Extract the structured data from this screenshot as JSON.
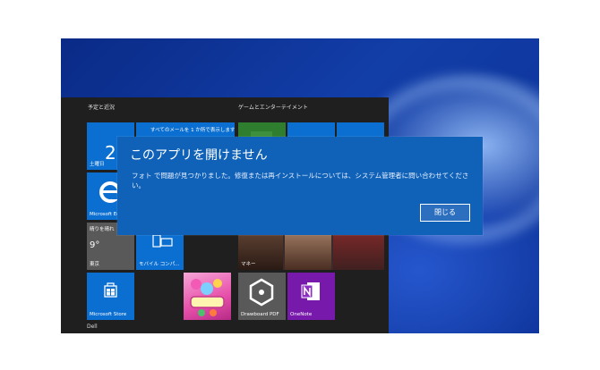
{
  "start_menu": {
    "group_schedule": "予定と近況",
    "group_games": "ゲームとエンターテイメント",
    "footer_user": "Dell",
    "tiles": {
      "calendar_day": "2",
      "mail_label": "すべてのメールを 1 か所で表示します",
      "calendar_label": "土曜日",
      "edge_label": "Microsoft Edge",
      "weather_label": "晴りを晴れ",
      "weather_temp": "9°",
      "weather_city": "東京",
      "mobile_label": "モバイル コンパ...",
      "news_label": "マネー",
      "store_label": "Microsoft Store",
      "drawboard_label": "Drawboard PDF",
      "onenote_label": "OneNote"
    }
  },
  "dialog": {
    "title": "このアプリを開けません",
    "message": "フォト で問題が見つかりました。修復または再インストールについては、システム管理者に問い合わせてください。",
    "close_label": "閉じる"
  },
  "colors": {
    "tile_blue": "#0a6fd1",
    "tile_purple": "#7719aa",
    "tile_gray": "#595959",
    "dialog_blue": "#1062b8",
    "start_bg": "#1f1f1f"
  }
}
